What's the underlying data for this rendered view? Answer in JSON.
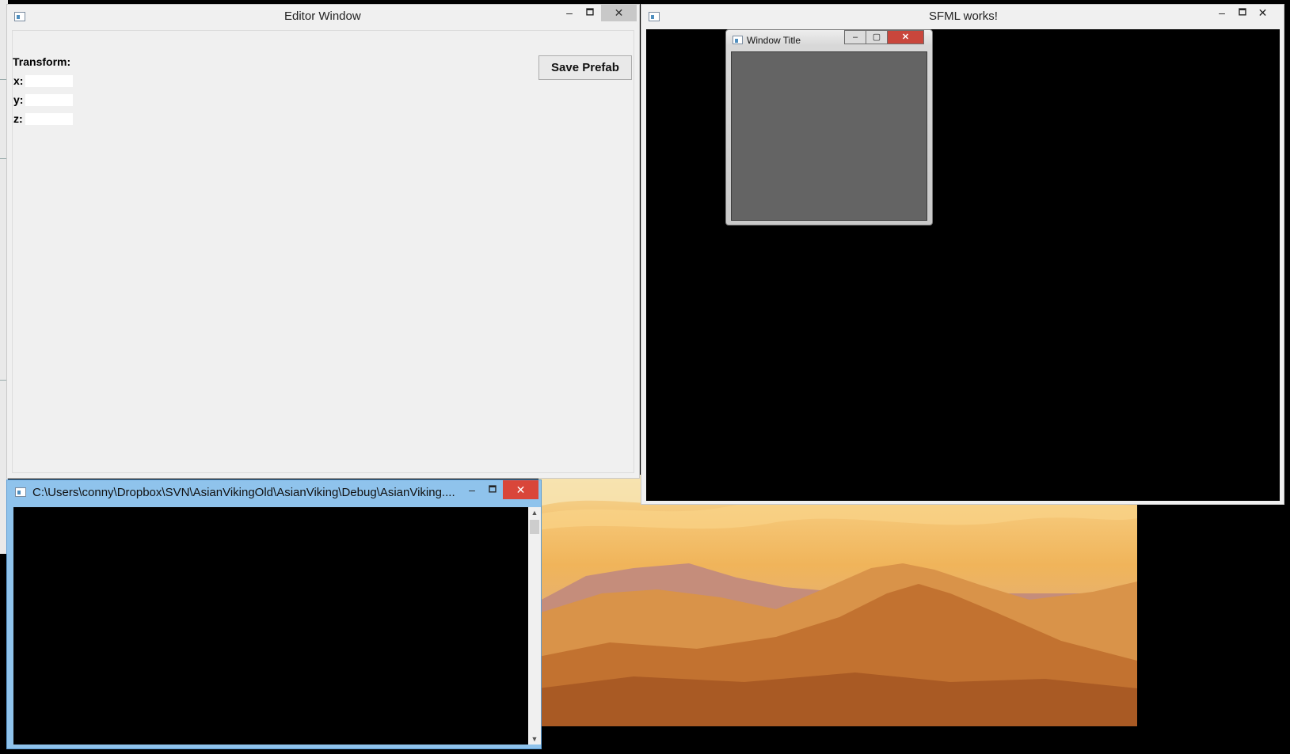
{
  "editor_window": {
    "title": "Editor Window",
    "section_label": "Transform:",
    "fields": [
      {
        "label": "x:",
        "value": ""
      },
      {
        "label": "y:",
        "value": ""
      },
      {
        "label": "z:",
        "value": ""
      }
    ],
    "save_button": "Save Prefab",
    "min_glyph": "–",
    "max_glyph": "🗖",
    "close_glyph": "✕"
  },
  "sfml_window": {
    "title": "SFML works!",
    "min_glyph": "–",
    "max_glyph": "🗖",
    "close_glyph": "✕"
  },
  "inner_window": {
    "title": "Window Title",
    "min_glyph": "–",
    "max_glyph": "▢",
    "close_glyph": "✕"
  },
  "console_window": {
    "title": "C:\\Users\\conny\\Dropbox\\SVN\\AsianVikingOld\\AsianViking\\Debug\\AsianViking....",
    "min_glyph": "–",
    "max_glyph": "🗖",
    "close_glyph": "✕",
    "scroll_up": "▲",
    "scroll_down": "▼"
  },
  "colors": {
    "console_border": "#8fc3ec",
    "close_active": "#d9463a",
    "sfml_canvas": "#000000",
    "inner_client": "#646464"
  }
}
